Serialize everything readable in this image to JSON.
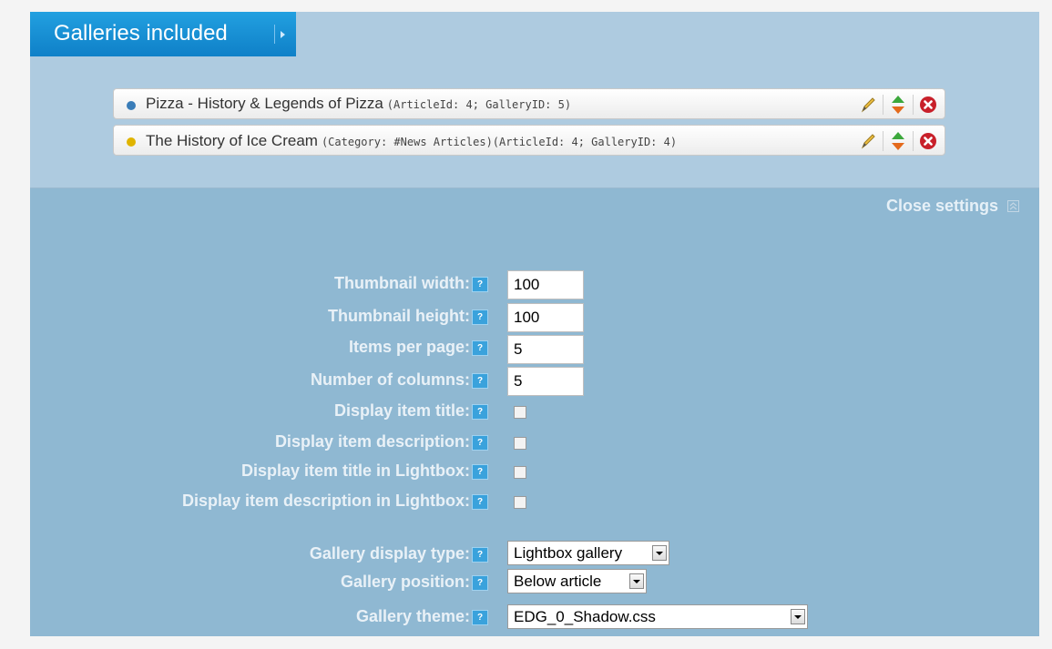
{
  "tab": {
    "title": "Galleries included"
  },
  "galleries": [
    {
      "title": "Pizza - History & Legends of Pizza",
      "meta": "(ArticleId: 4; GalleryID: 5)",
      "dot_color": "#3a7db8"
    },
    {
      "title": "The History of Ice Cream",
      "meta": "(Category: #News Articles)(ArticleId: 4; GalleryID: 4)",
      "dot_color": "#e0b400"
    }
  ],
  "settings": {
    "close_label": "Close settings",
    "help_glyph": "?",
    "thumb_width": {
      "label": "Thumbnail width:",
      "value": "100"
    },
    "thumb_height": {
      "label": "Thumbnail height:",
      "value": "100"
    },
    "items_per_page": {
      "label": "Items per page:",
      "value": "5"
    },
    "num_columns": {
      "label": "Number of columns:",
      "value": "5"
    },
    "display_title": {
      "label": "Display item title:"
    },
    "display_desc": {
      "label": "Display item description:"
    },
    "display_title_lb": {
      "label": "Display item title in Lightbox:"
    },
    "display_desc_lb": {
      "label": "Display item description in Lightbox:"
    },
    "display_type": {
      "label": "Gallery display type:",
      "value": "Lightbox gallery"
    },
    "position": {
      "label": "Gallery position:",
      "value": "Below article"
    },
    "theme": {
      "label": "Gallery theme:",
      "value": "EDG_0_Shadow.css"
    }
  },
  "colors": {
    "tab_bg": "#1a8fd6",
    "panel_bg": "#8fb8d2",
    "top_bg": "#aecbe0",
    "help_bg": "#3aa2dc"
  },
  "icons": [
    "chevron-right-icon",
    "edit-pencil-icon",
    "move-updown-icon",
    "delete-icon",
    "collapse-icon",
    "help-icon"
  ]
}
